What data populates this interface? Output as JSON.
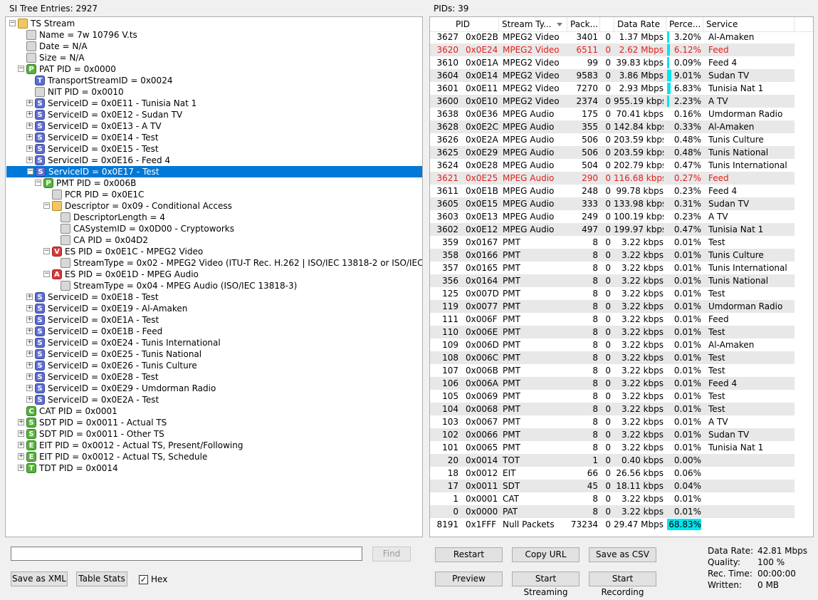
{
  "left_title": "SI Tree Entries: 2927",
  "right_title": "PIDs: 39",
  "tree": [
    {
      "d": 0,
      "exp": "minus",
      "icon": "folder",
      "glyph": "",
      "label": "TS Stream"
    },
    {
      "d": 1,
      "exp": "",
      "icon": "leaf",
      "glyph": "",
      "label": "Name = 7w 10796 V.ts"
    },
    {
      "d": 1,
      "exp": "",
      "icon": "leaf",
      "glyph": "",
      "label": "Date = N/A"
    },
    {
      "d": 1,
      "exp": "",
      "icon": "leaf",
      "glyph": "",
      "label": "Size = N/A"
    },
    {
      "d": 1,
      "exp": "minus",
      "icon": "P",
      "glyph": "P",
      "label": "PAT PID = 0x0000"
    },
    {
      "d": 2,
      "exp": "",
      "icon": "Tb",
      "glyph": "T",
      "label": "TransportStreamID = 0x0024"
    },
    {
      "d": 2,
      "exp": "",
      "icon": "leaf",
      "glyph": "",
      "label": "NIT PID = 0x0010"
    },
    {
      "d": 2,
      "exp": "plus",
      "icon": "S",
      "glyph": "S",
      "label": "ServiceID = 0x0E11 - Tunisia Nat 1"
    },
    {
      "d": 2,
      "exp": "plus",
      "icon": "S",
      "glyph": "S",
      "label": "ServiceID = 0x0E12 - Sudan TV"
    },
    {
      "d": 2,
      "exp": "plus",
      "icon": "S",
      "glyph": "S",
      "label": "ServiceID = 0x0E13 - A TV"
    },
    {
      "d": 2,
      "exp": "plus",
      "icon": "S",
      "glyph": "S",
      "label": "ServiceID = 0x0E14 - Test"
    },
    {
      "d": 2,
      "exp": "plus",
      "icon": "S",
      "glyph": "S",
      "label": "ServiceID = 0x0E15 - Test"
    },
    {
      "d": 2,
      "exp": "plus",
      "icon": "S",
      "glyph": "S",
      "label": "ServiceID = 0x0E16 - Feed 4"
    },
    {
      "d": 2,
      "exp": "minus",
      "icon": "S",
      "glyph": "S",
      "label": "ServiceID = 0x0E17 - Test",
      "selected": true
    },
    {
      "d": 3,
      "exp": "minus",
      "icon": "P",
      "glyph": "P",
      "label": "PMT PID = 0x006B"
    },
    {
      "d": 4,
      "exp": "",
      "icon": "leaf",
      "glyph": "",
      "label": "PCR PID = 0x0E1C"
    },
    {
      "d": 4,
      "exp": "minus",
      "icon": "folder",
      "glyph": "",
      "label": "Descriptor = 0x09 - Conditional Access"
    },
    {
      "d": 5,
      "exp": "",
      "icon": "leaf",
      "glyph": "",
      "label": "DescriptorLength = 4"
    },
    {
      "d": 5,
      "exp": "",
      "icon": "leaf",
      "glyph": "",
      "label": "CASystemID = 0x0D00 - Cryptoworks"
    },
    {
      "d": 5,
      "exp": "",
      "icon": "leaf",
      "glyph": "",
      "label": "CA PID = 0x04D2"
    },
    {
      "d": 4,
      "exp": "minus",
      "icon": "V",
      "glyph": "V",
      "label": "ES PID = 0x0E1C - MPEG2 Video"
    },
    {
      "d": 5,
      "exp": "",
      "icon": "leaf",
      "glyph": "",
      "label": "StreamType = 0x02 - MPEG2 Video (ITU-T Rec. H.262 | ISO/IEC 13818-2 or ISO/IEC 11172-2)"
    },
    {
      "d": 4,
      "exp": "minus",
      "icon": "A",
      "glyph": "A",
      "label": "ES PID = 0x0E1D - MPEG Audio"
    },
    {
      "d": 5,
      "exp": "",
      "icon": "leaf",
      "glyph": "",
      "label": "StreamType = 0x04 - MPEG Audio (ISO/IEC 13818-3)"
    },
    {
      "d": 2,
      "exp": "plus",
      "icon": "S",
      "glyph": "S",
      "label": "ServiceID = 0x0E18 - Test"
    },
    {
      "d": 2,
      "exp": "plus",
      "icon": "S",
      "glyph": "S",
      "label": "ServiceID = 0x0E19 - Al-Amaken"
    },
    {
      "d": 2,
      "exp": "plus",
      "icon": "S",
      "glyph": "S",
      "label": "ServiceID = 0x0E1A - Test"
    },
    {
      "d": 2,
      "exp": "plus",
      "icon": "S",
      "glyph": "S",
      "label": "ServiceID = 0x0E1B - Feed"
    },
    {
      "d": 2,
      "exp": "plus",
      "icon": "S",
      "glyph": "S",
      "label": "ServiceID = 0x0E24 - Tunis International"
    },
    {
      "d": 2,
      "exp": "plus",
      "icon": "S",
      "glyph": "S",
      "label": "ServiceID = 0x0E25 - Tunis National"
    },
    {
      "d": 2,
      "exp": "plus",
      "icon": "S",
      "glyph": "S",
      "label": "ServiceID = 0x0E26 - Tunis Culture"
    },
    {
      "d": 2,
      "exp": "plus",
      "icon": "S",
      "glyph": "S",
      "label": "ServiceID = 0x0E28 - Test"
    },
    {
      "d": 2,
      "exp": "plus",
      "icon": "S",
      "glyph": "S",
      "label": "ServiceID = 0x0E29 - Umdorman Radio"
    },
    {
      "d": 2,
      "exp": "plus",
      "icon": "S",
      "glyph": "S",
      "label": "ServiceID = 0x0E2A - Test"
    },
    {
      "d": 1,
      "exp": "",
      "icon": "C",
      "glyph": "C",
      "label": "CAT PID = 0x0001"
    },
    {
      "d": 1,
      "exp": "plus",
      "icon": "S",
      "glyph": "S",
      "label": "SDT PID = 0x0011 - Actual TS",
      "green": true
    },
    {
      "d": 1,
      "exp": "plus",
      "icon": "S",
      "glyph": "S",
      "label": "SDT PID = 0x0011 - Other TS",
      "green": true
    },
    {
      "d": 1,
      "exp": "plus",
      "icon": "E",
      "glyph": "E",
      "label": "EIT PID = 0x0012 - Actual TS, Present/Following"
    },
    {
      "d": 1,
      "exp": "plus",
      "icon": "E",
      "glyph": "E",
      "label": "EIT PID = 0x0012 - Actual TS, Schedule"
    },
    {
      "d": 1,
      "exp": "plus",
      "icon": "T",
      "glyph": "T",
      "label": "TDT PID = 0x0014"
    }
  ],
  "left_controls": {
    "search_value": "",
    "find_label": "Find",
    "save_xml_label": "Save as XML",
    "table_stats_label": "Table Stats",
    "hex_label": "Hex",
    "hex_checked": true
  },
  "table": {
    "headers": [
      "PID",
      "Stream Ty...",
      "Pack...",
      "",
      "Data Rate",
      "Perce...",
      "Service"
    ],
    "rows": [
      [
        "3627",
        "0x0E2B",
        "MPEG2 Video",
        "3401",
        "0",
        "1.37 Mbps",
        "3.20%",
        "Al-Amaken"
      ],
      [
        "3620",
        "0x0E24",
        "MPEG2 Video",
        "6511",
        "0",
        "2.62 Mbps",
        "6.12%",
        "Feed"
      ],
      [
        "3610",
        "0x0E1A",
        "MPEG2 Video",
        "99",
        "0",
        "39.83 kbps",
        "0.09%",
        "Feed 4"
      ],
      [
        "3604",
        "0x0E14",
        "MPEG2 Video",
        "9583",
        "0",
        "3.86 Mbps",
        "9.01%",
        "Sudan TV"
      ],
      [
        "3601",
        "0x0E11",
        "MPEG2 Video",
        "7270",
        "0",
        "2.93 Mbps",
        "6.83%",
        "Tunisia Nat 1"
      ],
      [
        "3600",
        "0x0E10",
        "MPEG2 Video",
        "2374",
        "0",
        "955.19 kbps",
        "2.23%",
        "A TV"
      ],
      [
        "3638",
        "0x0E36",
        "MPEG Audio",
        "175",
        "0",
        "70.41 kbps",
        "0.16%",
        "Umdorman Radio"
      ],
      [
        "3628",
        "0x0E2C",
        "MPEG Audio",
        "355",
        "0",
        "142.84 kbps",
        "0.33%",
        "Al-Amaken"
      ],
      [
        "3626",
        "0x0E2A",
        "MPEG Audio",
        "506",
        "0",
        "203.59 kbps",
        "0.48%",
        "Tunis Culture"
      ],
      [
        "3625",
        "0x0E29",
        "MPEG Audio",
        "506",
        "0",
        "203.59 kbps",
        "0.48%",
        "Tunis National"
      ],
      [
        "3624",
        "0x0E28",
        "MPEG Audio",
        "504",
        "0",
        "202.79 kbps",
        "0.47%",
        "Tunis International"
      ],
      [
        "3621",
        "0x0E25",
        "MPEG Audio",
        "290",
        "0",
        "116.68 kbps",
        "0.27%",
        "Feed"
      ],
      [
        "3611",
        "0x0E1B",
        "MPEG Audio",
        "248",
        "0",
        "99.78 kbps",
        "0.23%",
        "Feed 4"
      ],
      [
        "3605",
        "0x0E15",
        "MPEG Audio",
        "333",
        "0",
        "133.98 kbps",
        "0.31%",
        "Sudan TV"
      ],
      [
        "3603",
        "0x0E13",
        "MPEG Audio",
        "249",
        "0",
        "100.19 kbps",
        "0.23%",
        "A TV"
      ],
      [
        "3602",
        "0x0E12",
        "MPEG Audio",
        "497",
        "0",
        "199.97 kbps",
        "0.47%",
        "Tunisia Nat 1"
      ],
      [
        "359",
        "0x0167",
        "PMT",
        "8",
        "0",
        "3.22 kbps",
        "0.01%",
        "Test"
      ],
      [
        "358",
        "0x0166",
        "PMT",
        "8",
        "0",
        "3.22 kbps",
        "0.01%",
        "Tunis Culture"
      ],
      [
        "357",
        "0x0165",
        "PMT",
        "8",
        "0",
        "3.22 kbps",
        "0.01%",
        "Tunis International"
      ],
      [
        "356",
        "0x0164",
        "PMT",
        "8",
        "0",
        "3.22 kbps",
        "0.01%",
        "Tunis National"
      ],
      [
        "125",
        "0x007D",
        "PMT",
        "8",
        "0",
        "3.22 kbps",
        "0.01%",
        "Test"
      ],
      [
        "119",
        "0x0077",
        "PMT",
        "8",
        "0",
        "3.22 kbps",
        "0.01%",
        "Umdorman Radio"
      ],
      [
        "111",
        "0x006F",
        "PMT",
        "8",
        "0",
        "3.22 kbps",
        "0.01%",
        "Feed"
      ],
      [
        "110",
        "0x006E",
        "PMT",
        "8",
        "0",
        "3.22 kbps",
        "0.01%",
        "Test"
      ],
      [
        "109",
        "0x006D",
        "PMT",
        "8",
        "0",
        "3.22 kbps",
        "0.01%",
        "Al-Amaken"
      ],
      [
        "108",
        "0x006C",
        "PMT",
        "8",
        "0",
        "3.22 kbps",
        "0.01%",
        "Test"
      ],
      [
        "107",
        "0x006B",
        "PMT",
        "8",
        "0",
        "3.22 kbps",
        "0.01%",
        "Test"
      ],
      [
        "106",
        "0x006A",
        "PMT",
        "8",
        "0",
        "3.22 kbps",
        "0.01%",
        "Feed 4"
      ],
      [
        "105",
        "0x0069",
        "PMT",
        "8",
        "0",
        "3.22 kbps",
        "0.01%",
        "Test"
      ],
      [
        "104",
        "0x0068",
        "PMT",
        "8",
        "0",
        "3.22 kbps",
        "0.01%",
        "Test"
      ],
      [
        "103",
        "0x0067",
        "PMT",
        "8",
        "0",
        "3.22 kbps",
        "0.01%",
        "A TV"
      ],
      [
        "102",
        "0x0066",
        "PMT",
        "8",
        "0",
        "3.22 kbps",
        "0.01%",
        "Sudan TV"
      ],
      [
        "101",
        "0x0065",
        "PMT",
        "8",
        "0",
        "3.22 kbps",
        "0.01%",
        "Tunisia Nat 1"
      ],
      [
        "20",
        "0x0014",
        "TOT",
        "1",
        "0",
        "0.40 kbps",
        "0.00%",
        ""
      ],
      [
        "18",
        "0x0012",
        "EIT",
        "66",
        "0",
        "26.56 kbps",
        "0.06%",
        ""
      ],
      [
        "17",
        "0x0011",
        "SDT",
        "45",
        "0",
        "18.11 kbps",
        "0.04%",
        ""
      ],
      [
        "1",
        "0x0001",
        "CAT",
        "8",
        "0",
        "3.22 kbps",
        "0.01%",
        ""
      ],
      [
        "0",
        "0x0000",
        "PAT",
        "8",
        "0",
        "3.22 kbps",
        "0.01%",
        ""
      ],
      [
        "8191",
        "0x1FFF",
        "Null Packets",
        "73234",
        "0",
        "29.47 Mbps",
        "68.83%",
        ""
      ]
    ],
    "red_rows": [
      1,
      11
    ],
    "percent_bars": [
      0.032,
      0.0612,
      0.0009,
      0.0901,
      0.0683,
      0.0223,
      0,
      0,
      0,
      0,
      0,
      0,
      0,
      0,
      0,
      0,
      0,
      0,
      0,
      0,
      0,
      0,
      0,
      0,
      0,
      0,
      0,
      0,
      0,
      0,
      0,
      0,
      0,
      0,
      0,
      0,
      0,
      0,
      0.6883
    ]
  },
  "right_controls": {
    "restart_label": "Restart",
    "copy_url_label": "Copy URL",
    "save_csv_label": "Save as CSV",
    "preview_label": "Preview",
    "start_streaming_label": "Start Streaming",
    "start_recording_label": "Start Recording"
  },
  "stats": [
    {
      "label": "Data Rate:",
      "value": "42.81 Mbps"
    },
    {
      "label": "Quality:",
      "value": "100 %"
    },
    {
      "label": "Rec. Time:",
      "value": "00:00:00"
    },
    {
      "label": "Written:",
      "value": "0 MB"
    }
  ],
  "colors": {
    "selection": "#0078d7",
    "highlight_row_text": "#e0201c",
    "percent_bar": "#00e5ee"
  }
}
